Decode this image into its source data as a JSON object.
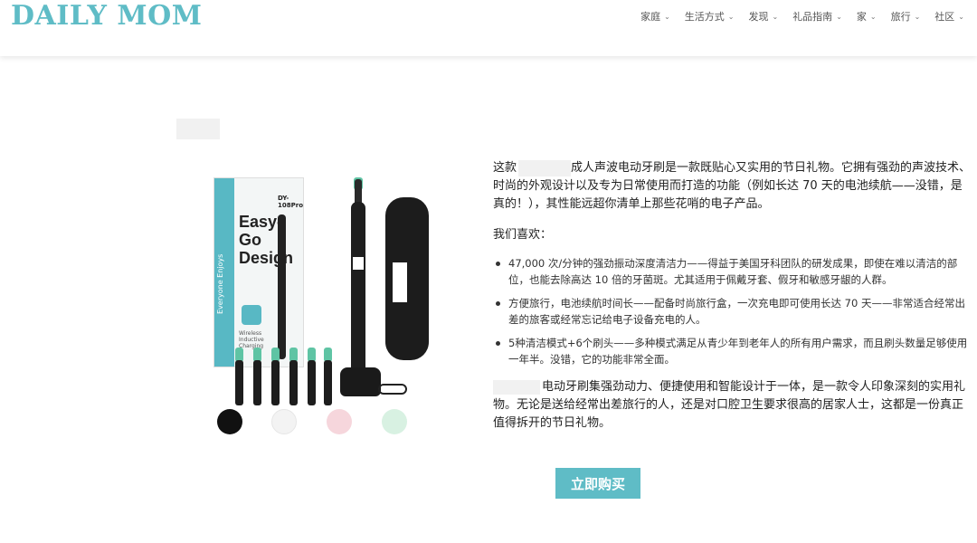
{
  "header": {
    "logo": "DAILY MOM",
    "nav": [
      {
        "label": "家庭"
      },
      {
        "label": "生活方式"
      },
      {
        "label": "发现"
      },
      {
        "label": "礼品指南"
      },
      {
        "label": "家"
      },
      {
        "label": "旅行"
      },
      {
        "label": "社区"
      }
    ]
  },
  "product_image": {
    "box_model": "DY-108Pro",
    "box_title_line1": "Easy-Go",
    "box_title_line2": "Design",
    "box_side_text": "Everyone Enjoys",
    "box_feature": "Wireless Inductive Charging",
    "swatch_colors": [
      "#111111",
      "#f3f3f3",
      "#f6d6dc",
      "#d8f1e2"
    ]
  },
  "article": {
    "intro_before": "这款",
    "intro_after": "成人声波电动牙刷是一款既贴心又实用的节日礼物。它拥有强劲的声波技术、时尚的外观设计以及专为日常使用而打造的功能（例如长达 70 天的电池续航——没错，是真的！），其性能远超你清单上那些花哨的电子产品。",
    "we_like": "我们喜欢：",
    "bullets": [
      "47,000 次/分钟的强劲振动深度清洁力——得益于美国牙科团队的研发成果，即使在难以清洁的部位，也能去除高达 10 倍的牙菌斑。尤其适用于佩戴牙套、假牙和敏感牙龈的人群。",
      "方便旅行，电池续航时间长——配备时尚旅行盒，一次充电即可使用长达 70 天——非常适合经常出差的旅客或经常忘记给电子设备充电的人。",
      "5种清洁模式+6个刷头——多种模式满足从青少年到老年人的所有用户需求，而且刷头数量足够使用一年半。没错，它的功能非常全面。"
    ],
    "summary": "电动牙刷集强劲动力、便捷使用和智能设计于一体，是一款令人印象深刻的实用礼物。无论是送给经常出差旅行的人，还是对口腔卫生要求很高的居家人士，这都是一份真正值得拆开的节日礼物。"
  },
  "cta": {
    "buy_label": "立即购买"
  },
  "colors": {
    "accent": "#5fbcc6"
  }
}
